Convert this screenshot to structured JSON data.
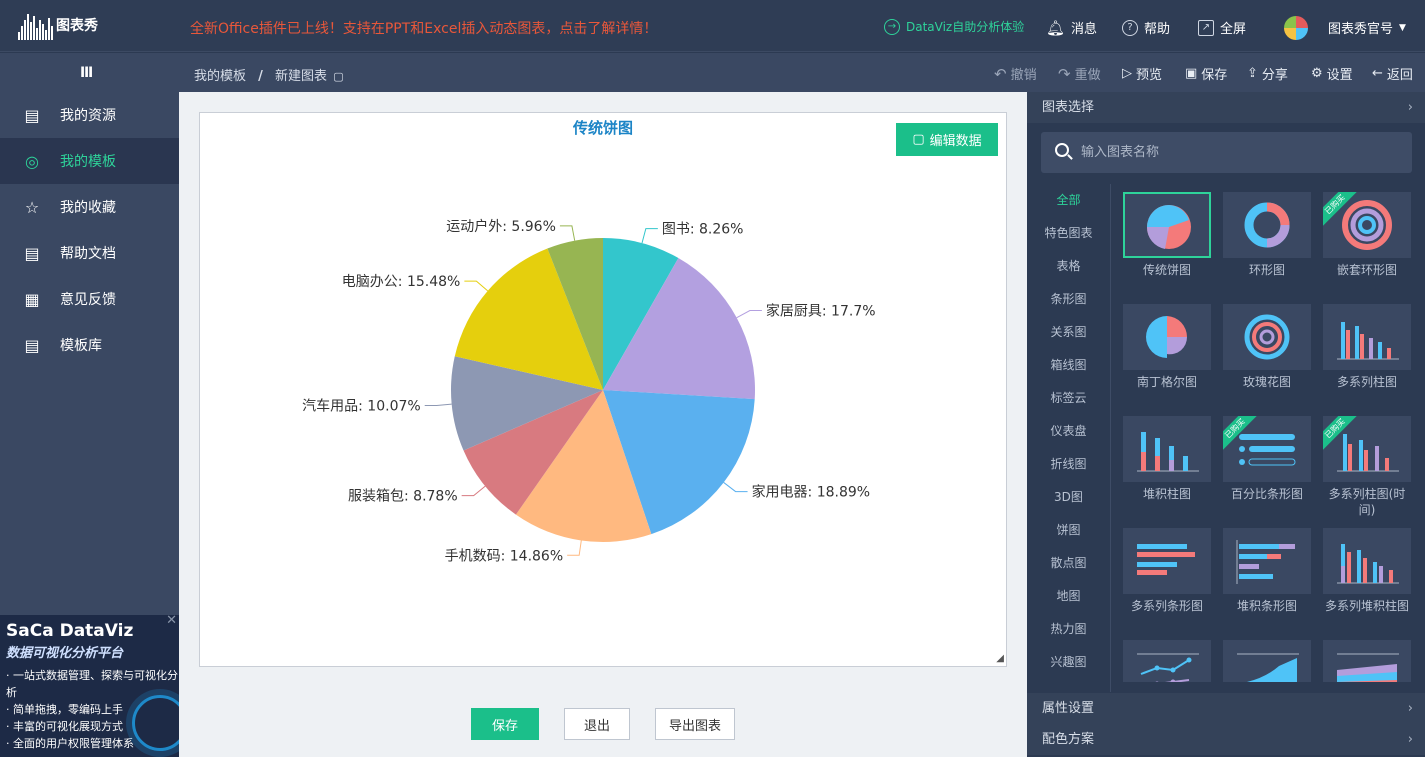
{
  "topbar": {
    "logo_text": "图表秀",
    "announcement": "全新Office插件已上线！支持在PPT和Excel插入动态图表，点击了解详情！",
    "dataviz": "DataViz自助分析体验",
    "messages": "消息",
    "help": "帮助",
    "fullscreen": "全屏",
    "account": "图表秀官号"
  },
  "subbar": {
    "menu_icon": "Ⅲ",
    "breadcrumb_parent": "我的模板",
    "breadcrumb_sep": "/",
    "breadcrumb_current": "新建图表",
    "undo": "撤销",
    "redo": "重做",
    "preview": "预览",
    "save": "保存",
    "share": "分享",
    "settings": "设置",
    "back": "返回"
  },
  "sidebar": {
    "items": [
      {
        "label": "我的资源",
        "icon": "document-icon"
      },
      {
        "label": "我的模板",
        "icon": "target-icon"
      },
      {
        "label": "我的收藏",
        "icon": "star-icon"
      },
      {
        "label": "帮助文档",
        "icon": "help-doc-icon"
      },
      {
        "label": "意见反馈",
        "icon": "feedback-icon"
      },
      {
        "label": "模板库",
        "icon": "library-icon"
      }
    ],
    "active_index": 1
  },
  "promo": {
    "title": "SaCa DataViz",
    "subtitle": "数据可视化分析平台",
    "bullets": [
      "一站式数据管理、探索与可视化分析",
      "简单拖拽，零编码上手",
      "丰富的可视化展现方式",
      "全面的用户权限管理体系"
    ],
    "close": "✕"
  },
  "canvas": {
    "edit_data": "编辑数据"
  },
  "chart_data": {
    "type": "pie",
    "title": "传统饼图",
    "categories": [
      "图书",
      "家居厨具",
      "家用电器",
      "手机数码",
      "服装箱包",
      "汽车用品",
      "电脑办公",
      "运动户外"
    ],
    "values": [
      8.26,
      17.7,
      18.89,
      14.86,
      8.78,
      10.07,
      15.48,
      5.96
    ],
    "labels": [
      "图书: 8.26%",
      "家居厨具: 17.7%",
      "家用电器: 18.89%",
      "手机数码: 14.86%",
      "服装箱包: 8.78%",
      "汽车用品: 10.07%",
      "电脑办公: 15.48%",
      "运动户外: 5.96%"
    ],
    "colors": [
      "#33c6cc",
      "#b3a0e0",
      "#5ab0ef",
      "#ffb980",
      "#d87a80",
      "#8d98b3",
      "#e5cf0d",
      "#97b552"
    ],
    "legend": "none"
  },
  "bottom": {
    "save": "保存",
    "exit": "退出",
    "export": "导出图表"
  },
  "right": {
    "chart_select": "图表选择",
    "search_placeholder": "输入图表名称",
    "categories": [
      "全部",
      "特色图表",
      "表格",
      "条形图",
      "关系图",
      "箱线图",
      "标签云",
      "仪表盘",
      "折线图",
      "3D图",
      "饼图",
      "散点图",
      "地图",
      "热力图",
      "兴趣图"
    ],
    "tiles": [
      {
        "label": "传统饼图"
      },
      {
        "label": "环形图"
      },
      {
        "label": "嵌套环形图",
        "badge": "已购买"
      },
      {
        "label": "南丁格尔图"
      },
      {
        "label": "玫瑰花图"
      },
      {
        "label": "多系列柱图"
      },
      {
        "label": "堆积柱图"
      },
      {
        "label": "百分比条形图",
        "badge": "已购买"
      },
      {
        "label": "多系列柱图(时间)",
        "badge": "已购买"
      },
      {
        "label": "多系列条形图"
      },
      {
        "label": "堆积条形图"
      },
      {
        "label": "多系列堆积柱图"
      },
      {
        "label": ""
      },
      {
        "label": ""
      },
      {
        "label": ""
      }
    ],
    "property_settings": "属性设置",
    "color_scheme": "配色方案"
  }
}
